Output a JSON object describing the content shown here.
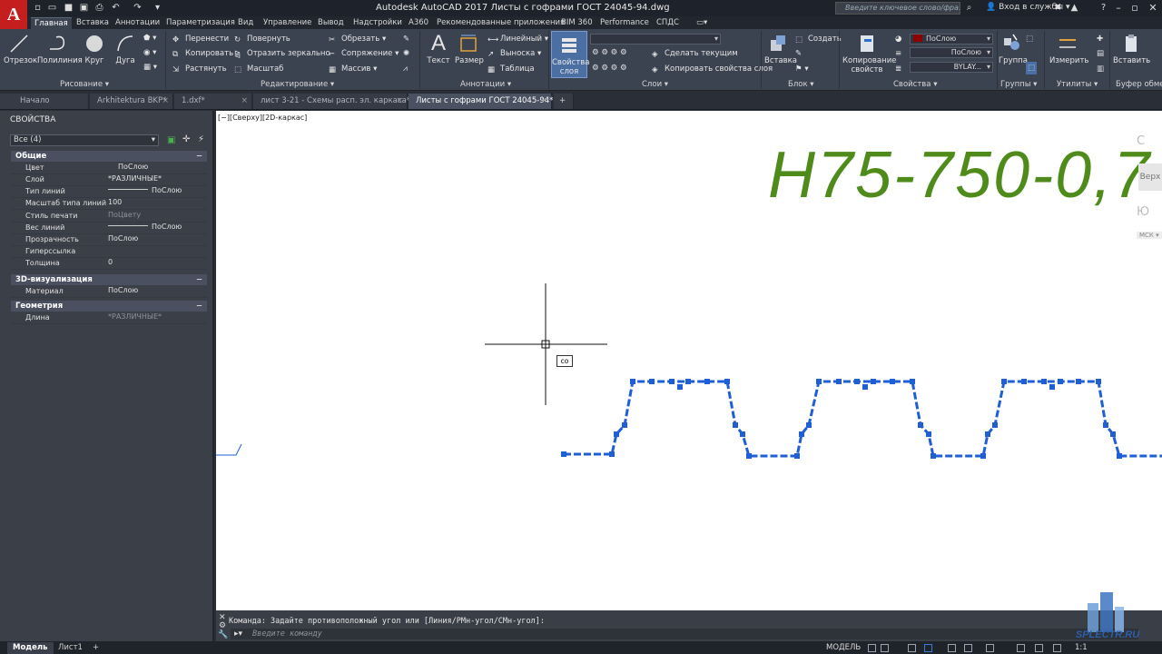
{
  "titlebar": {
    "app_letter": "A",
    "title": "Autodesk AutoCAD 2017    Листы с гофрами ГОСТ 24045-94.dwg",
    "search_placeholder": "Введите ключевое слово/фразу",
    "login": "Вход в службы"
  },
  "menu": {
    "tabs": [
      "Главная",
      "Вставка",
      "Аннотации",
      "Параметризация",
      "Вид",
      "Управление",
      "Вывод",
      "Надстройки",
      "A360",
      "Рекомендованные приложения",
      "BIM 360",
      "Performance",
      "СПДС"
    ],
    "active": "Главная"
  },
  "ribbon": {
    "draw": {
      "title": "Рисование",
      "line": "Отрезок",
      "polyline": "Полилиния",
      "circle": "Круг",
      "arc": "Дуга"
    },
    "modify": {
      "title": "Редактирование",
      "move": "Перенести",
      "rotate": "Повернуть",
      "trim": "Обрезать",
      "copy": "Копировать",
      "mirror": "Отразить зеркально",
      "fillet": "Сопряжение",
      "stretch": "Растянуть",
      "scale": "Масштаб",
      "array": "Массив"
    },
    "annotation": {
      "title": "Аннотации",
      "text": "Текст",
      "dimension": "Размер",
      "linear": "Линейный",
      "leader": "Выноска",
      "table": "Таблица"
    },
    "layers": {
      "title": "Слои",
      "layer_props_1": "Свойства",
      "layer_props_2": "слоя",
      "make_current": "Сделать текущим",
      "match_layer": "Копировать свойства слоя"
    },
    "block": {
      "title": "Блок",
      "insert": "Вставка",
      "create": "Создать"
    },
    "properties": {
      "title": "Свойства",
      "match_1": "Копирование",
      "match_2": "свойств",
      "color": "ПоСлою",
      "linetype": "ПоСлою",
      "lineweight": "BYLAY..."
    },
    "groups": {
      "title": "Группы",
      "group": "Группа"
    },
    "utilities": {
      "title": "Утилиты",
      "measure": "Измерить"
    },
    "clipboard": {
      "title": "Буфер обмен",
      "paste": "Вставить"
    },
    "colors": {
      "accent_red": "#c41e1e",
      "color_swatch": "#8b0000"
    }
  },
  "doc_tabs": [
    {
      "label": "Начало",
      "active": false
    },
    {
      "label": "Arkhitektura BKP*",
      "active": false
    },
    {
      "label": "1.dxf*",
      "active": false
    },
    {
      "label": "лист 3-21 - Схемы расп. эл. каркаса*",
      "active": false
    },
    {
      "label": "Листы с гофрами ГОСТ 24045-94*",
      "active": true
    }
  ],
  "properties": {
    "title": "СВОЙСТВА",
    "selection": "Все (4)",
    "sections": {
      "general": "Общие",
      "viz3d": "3D-визуализация",
      "geometry": "Геометрия"
    },
    "general_rows": [
      {
        "name": "Цвет",
        "value": "ПоСлою"
      },
      {
        "name": "Слой",
        "value": "*РАЗЛИЧНЫЕ*"
      },
      {
        "name": "Тип линий",
        "value": "ПоСлою"
      },
      {
        "name": "Масштаб типа линий",
        "value": "100"
      },
      {
        "name": "Стиль печати",
        "value": "ПоЦвету"
      },
      {
        "name": "Вес линий",
        "value": "ПоСлою"
      },
      {
        "name": "Прозрачность",
        "value": "ПоСлою"
      },
      {
        "name": "Гиперссылка",
        "value": ""
      },
      {
        "name": "Толщина",
        "value": "0"
      }
    ],
    "viz_rows": [
      {
        "name": "Материал",
        "value": "ПоСлою"
      }
    ],
    "geometry_rows": [
      {
        "name": "Длина",
        "value": "*РАЗЛИЧНЫЕ*"
      }
    ]
  },
  "drawing": {
    "view_label": "[−][Сверху][2D-каркас]",
    "big_text": "H75-750-0,7",
    "text_color": "#4e8b1a",
    "cursor_input": "co",
    "viewcube": {
      "top": "С",
      "face": "Верх",
      "bottom": "Ю",
      "ucs": "МСК"
    },
    "selection_color": "#1f5fd6"
  },
  "command": {
    "history": "Команда: Задайте противоположный угол или [Линия/РМн-угол/СМн-угол]:",
    "placeholder": "Введите команду"
  },
  "statusbar": {
    "tabs": [
      "Модель",
      "Лист1"
    ],
    "active": "Модель",
    "mode": "МОДЕЛЬ",
    "scale": "1:1"
  },
  "watermark": {
    "text": "SPLECTR.RU"
  }
}
